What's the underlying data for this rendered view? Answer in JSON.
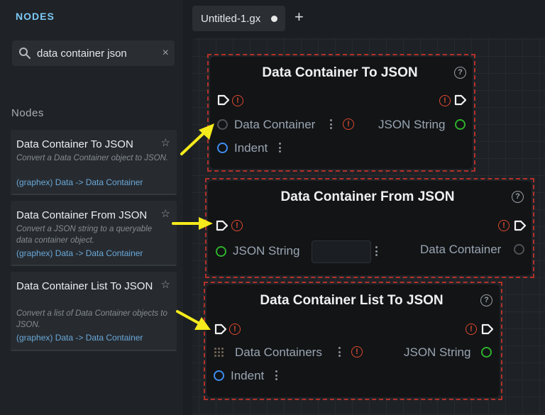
{
  "sidebar": {
    "title": "NODES",
    "search": {
      "value": "data container json",
      "placeholder": ""
    },
    "section_label": "Nodes",
    "cards": [
      {
        "title": "Data Container To JSON",
        "description": "Convert a Data Container object to JSON.",
        "path": "(graphex) Data -> Data Container"
      },
      {
        "title": "Data Container From JSON",
        "description": "Convert a JSON string to a queryable data container object.",
        "path": "(graphex) Data -> Data Container"
      },
      {
        "title": "Data Container List To JSON",
        "description": "Convert a list of Data Container objects to JSON.",
        "path": "(graphex) Data -> Data Container"
      }
    ]
  },
  "tabs": [
    {
      "label": "Untitled-1.gx",
      "unsaved": true
    }
  ],
  "nodes": [
    {
      "title": "Data Container To JSON",
      "inputs": [
        {
          "label": "Data Container",
          "color": "#5a5e63"
        },
        {
          "label": "Indent",
          "color": "#3f8df0"
        }
      ],
      "outputs": [
        {
          "label": "JSON String",
          "color": "#2fb12c"
        }
      ]
    },
    {
      "title": "Data Container From JSON",
      "inputs": [
        {
          "label": "JSON String",
          "color": "#2fb12c"
        }
      ],
      "outputs": [
        {
          "label": "Data Container",
          "color": "#5a5e63"
        }
      ]
    },
    {
      "title": "Data Container List To JSON",
      "inputs": [
        {
          "label": "Data Containers",
          "color": "#6b5f50"
        },
        {
          "label": "Indent",
          "color": "#3f8df0"
        }
      ],
      "outputs": [
        {
          "label": "JSON String",
          "color": "#2fb12c"
        }
      ]
    }
  ],
  "colors": {
    "selection_outline": "#b3312a",
    "highlight_arrow": "#f5ea1c",
    "accent": "#7cc8f5",
    "warning": "#e0492f"
  },
  "icons": {
    "help": "?",
    "warning": "!",
    "close": "×",
    "add": "+",
    "favorite": "☆"
  }
}
